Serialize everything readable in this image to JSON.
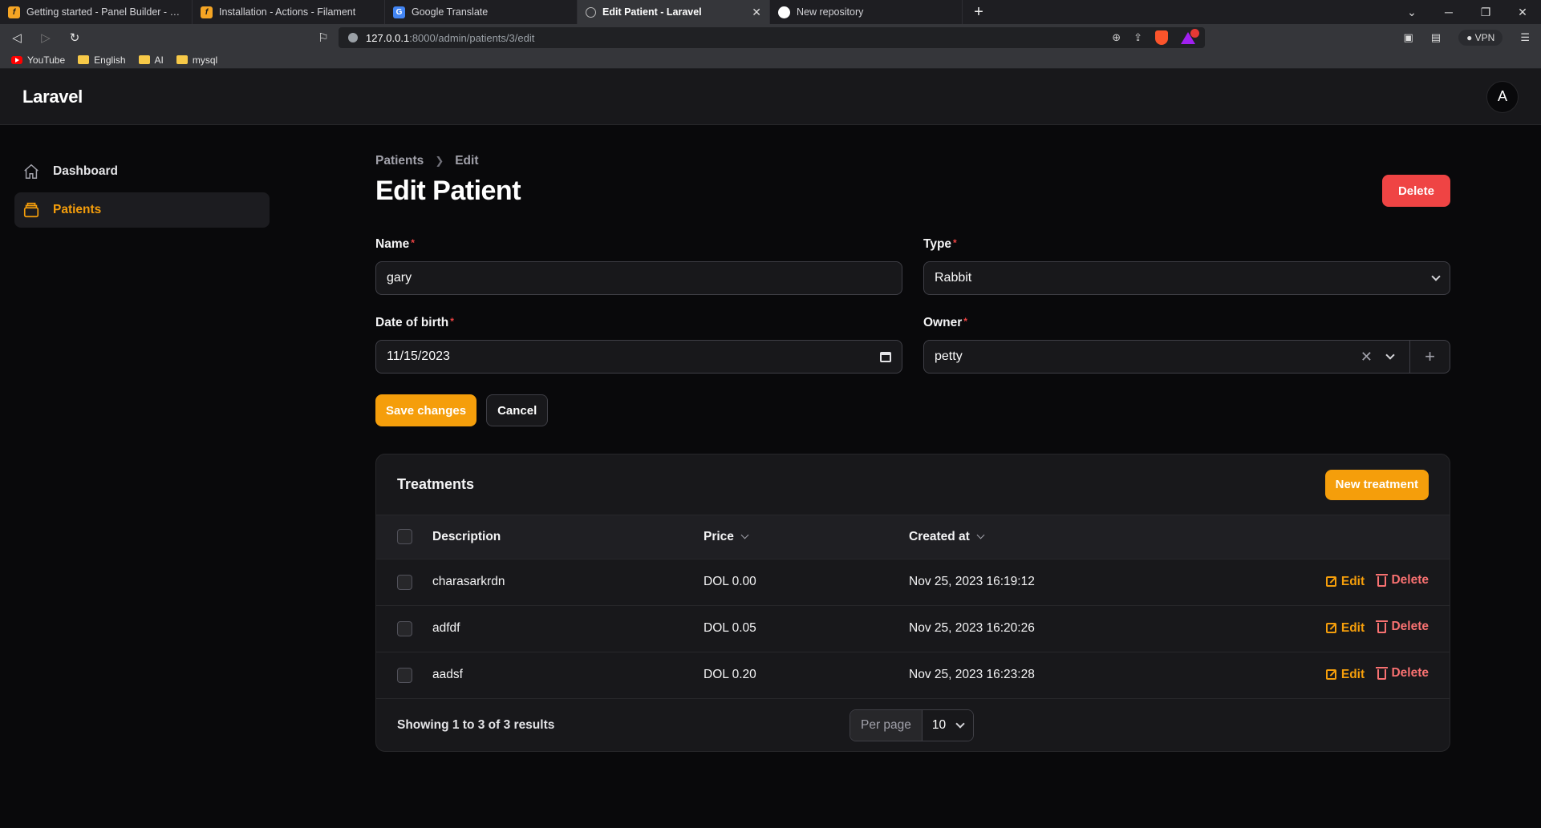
{
  "browser": {
    "tabs": [
      {
        "label": "Getting started - Panel Builder - Filament",
        "icon": "filament-icon"
      },
      {
        "label": "Installation - Actions - Filament",
        "icon": "filament-icon"
      },
      {
        "label": "Google Translate",
        "icon": "google-translate-icon"
      },
      {
        "label": "Edit Patient - Laravel",
        "icon": "globe-icon",
        "active": true
      },
      {
        "label": "New repository",
        "icon": "github-icon"
      }
    ],
    "url_host": "127.0.0.1",
    "url_path": ":8000/admin/patients/3/edit",
    "vpn_label": "VPN",
    "bookmarks": [
      "YouTube",
      "English",
      "AI",
      "mysql"
    ]
  },
  "app": {
    "brand": "Laravel",
    "avatar_initial": "A",
    "nav": [
      {
        "label": "Dashboard",
        "icon": "home-icon",
        "active": false
      },
      {
        "label": "Patients",
        "icon": "patients-icon",
        "active": true
      }
    ]
  },
  "page": {
    "breadcrumb": [
      "Patients",
      "Edit"
    ],
    "title": "Edit Patient",
    "delete_label": "Delete"
  },
  "form": {
    "name_label": "Name",
    "name_value": "gary",
    "type_label": "Type",
    "type_value": "Rabbit",
    "dob_label": "Date of birth",
    "dob_value": "11/15/2023",
    "owner_label": "Owner",
    "owner_value": "petty",
    "required_mark": "*",
    "save_label": "Save changes",
    "cancel_label": "Cancel"
  },
  "treatments": {
    "title": "Treatments",
    "new_label": "New treatment",
    "columns": [
      "Description",
      "Price",
      "Created at"
    ],
    "rows": [
      {
        "description": "charasarkrdn",
        "price": "DOL 0.00",
        "created_at": "Nov 25, 2023 16:19:12"
      },
      {
        "description": "adfdf",
        "price": "DOL 0.05",
        "created_at": "Nov 25, 2023 16:20:26"
      },
      {
        "description": "aadsf",
        "price": "DOL 0.20",
        "created_at": "Nov 25, 2023 16:23:28"
      }
    ],
    "edit_label": "Edit",
    "delete_label": "Delete",
    "showing": "Showing 1 to 3 of 3 results",
    "per_page_label": "Per page",
    "per_page_value": "10"
  },
  "colors": {
    "accent": "#f59e0b",
    "danger": "#ef4444",
    "background": "#09090b"
  }
}
